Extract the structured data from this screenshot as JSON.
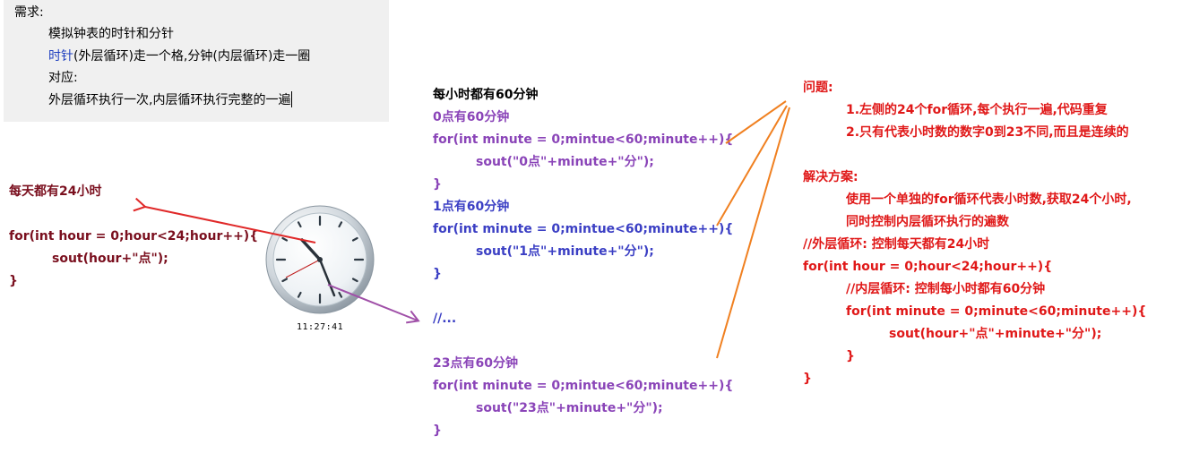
{
  "requirements": {
    "title": "需求:",
    "line1": "模拟钟表的时针和分针",
    "line2_blue": "时针",
    "line2_rest": "(外层循环)走一个格,分钟(内层循环)走一圈",
    "line3": "对应:",
    "line4": "外层循环执行一次,内层循环执行完整的一遍"
  },
  "left_code": {
    "heading": "每天都有24小时",
    "line1": "for(int hour = 0;hour<24;hour++){",
    "line2": "sout(hour+\"点\");",
    "line3": "}"
  },
  "clock": {
    "time": "11:27:41"
  },
  "middle_code": {
    "heading": "每小时都有60分钟",
    "block0_label": "0点有60分钟",
    "block0_for": "for(int minute = 0;mintue<60;minute++){",
    "block0_sout": "sout(\"0点\"+minute+\"分\");",
    "block0_close": "}",
    "block1_label": "1点有60分钟",
    "block1_for": "for(int minute = 0;mintue<60;minute++){",
    "block1_sout": "sout(\"1点\"+minute+\"分\");",
    "block1_close": "}",
    "ellipsis": "//...",
    "block23_label": "23点有60分钟",
    "block23_for": "for(int minute = 0;mintue<60;minute++){",
    "block23_sout": "sout(\"23点\"+minute+\"分\");",
    "block23_close": "}"
  },
  "right_panel": {
    "problem_title": "问题:",
    "problem1": "1.左侧的24个for循环,每个执行一遍,代码重复",
    "problem2": "2.只有代表小时数的数字0到23不同,而且是连续的",
    "solution_title": "解决方案:",
    "solution1": "使用一个单独的for循环代表小时数,获取24个小时,",
    "solution2": "同时控制内层循环执行的遍数",
    "comment_outer": "//外层循环: 控制每天都有24小时",
    "for_outer": "for(int hour = 0;hour<24;hour++){",
    "comment_inner": "//内层循环: 控制每小时都有60分钟",
    "for_inner": "for(int minute = 0;minute<60;minute++){",
    "sout": "sout(hour+\"点\"+minute+\"分\");",
    "close_inner": "}",
    "close_outer": "}"
  },
  "colors": {
    "dark_red": "#7a0f1e",
    "purple": "#8a44b8",
    "blue": "#3b3fc4",
    "red": "#e01818",
    "orange": "#f08020",
    "arrow_red": "#e02828",
    "arrow_purple": "#a050a8"
  }
}
